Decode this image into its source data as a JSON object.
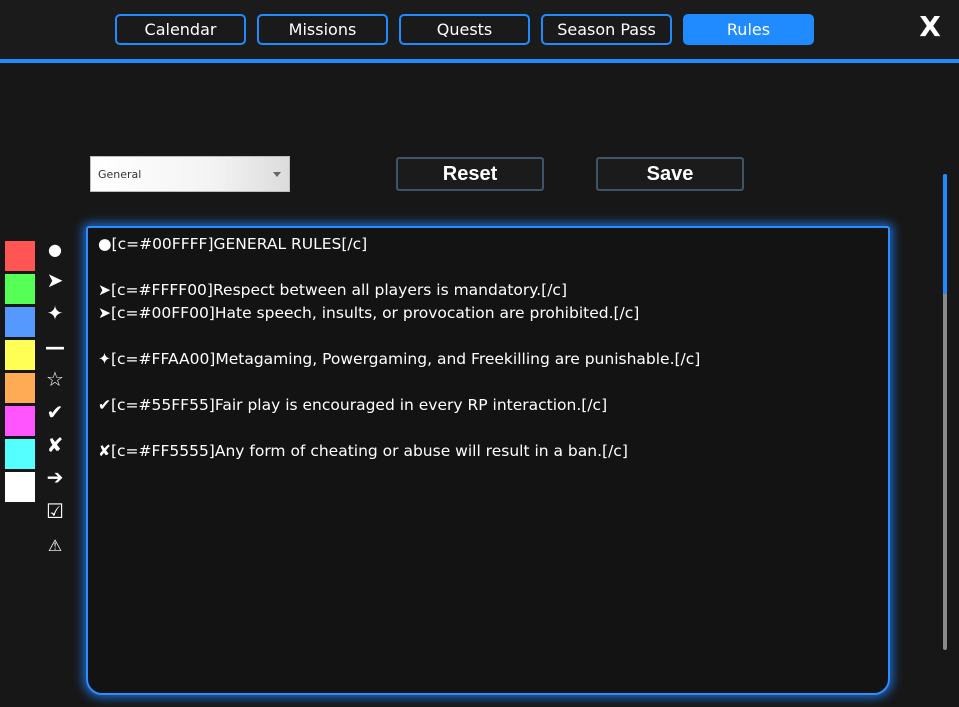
{
  "tabs": [
    {
      "label": "Calendar",
      "active": false
    },
    {
      "label": "Missions",
      "active": false
    },
    {
      "label": "Quests",
      "active": false
    },
    {
      "label": "Season Pass",
      "active": false
    },
    {
      "label": "Rules",
      "active": true
    }
  ],
  "close_label": "X",
  "category_select": {
    "value": "General"
  },
  "actions": {
    "reset_label": "Reset",
    "save_label": "Save"
  },
  "palette": {
    "colors": [
      "#FF5555",
      "#55FF55",
      "#5599FF",
      "#FFFF55",
      "#FFAA55",
      "#FF55FF",
      "#55FFFF",
      "#FFFFFF"
    ],
    "symbols": [
      {
        "glyph": "●",
        "icon": "bullet-icon"
      },
      {
        "glyph": "➤",
        "icon": "arrowhead-icon"
      },
      {
        "glyph": "✦",
        "icon": "four-point-star-icon"
      },
      {
        "glyph": "—",
        "icon": "dash-icon"
      },
      {
        "glyph": "☆",
        "icon": "star-outline-icon"
      },
      {
        "glyph": "✔",
        "icon": "check-icon"
      },
      {
        "glyph": "✘",
        "icon": "cross-icon"
      },
      {
        "glyph": "➔",
        "icon": "arrow-right-icon"
      },
      {
        "glyph": "☑",
        "icon": "checkbox-icon"
      },
      {
        "glyph": "⚠",
        "icon": "warning-icon"
      }
    ]
  },
  "editor": {
    "lines": [
      "●[c=#00FFFF]GENERAL RULES[/c]",
      "",
      "➤[c=#FFFF00]Respect between all players is mandatory.[/c]",
      "➤[c=#00FF00]Hate speech, insults, or provocation are prohibited.[/c]",
      "",
      "✦[c=#FFAA00]Metagaming, Powergaming, and Freekilling are punishable.[/c]",
      "",
      "✔[c=#55FF55]Fair play is encouraged in every RP interaction.[/c]",
      "",
      "✘[c=#FF5555]Any form of cheating or abuse will result in a ban.[/c]"
    ]
  }
}
